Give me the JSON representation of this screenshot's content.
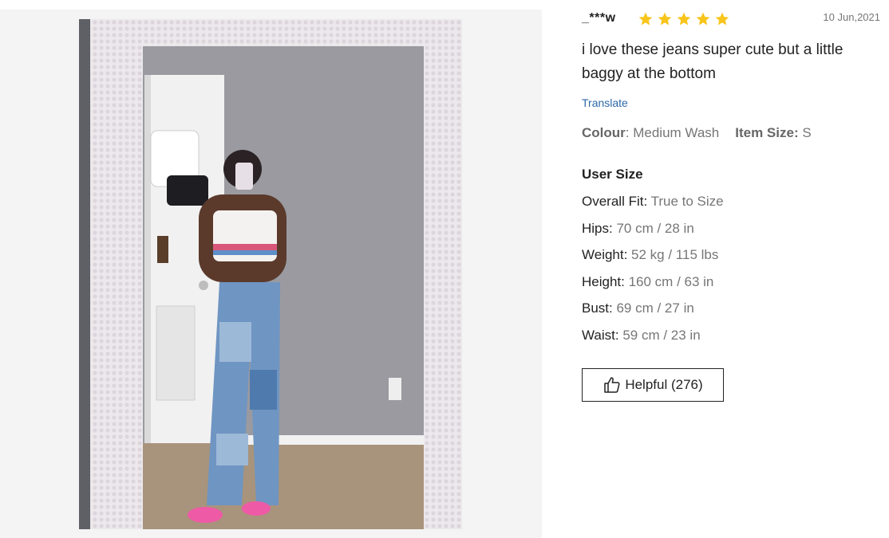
{
  "review": {
    "username": "_***w",
    "rating": 5,
    "rating_max": 5,
    "date": "10 Jun,2021",
    "comment": "i love these jeans super cute but a little baggy at the bottom",
    "translate_label": "Translate",
    "attributes": {
      "colour_label": "Colour",
      "colour_value": ": Medium Wash",
      "item_size_label": "Item Size:",
      "item_size_value": " S"
    },
    "user_size": {
      "title": "User Size",
      "rows": [
        {
          "label": "Overall Fit:",
          "value": " True to Size"
        },
        {
          "label": "Hips:",
          "value": " 70 cm / 28 in"
        },
        {
          "label": "Weight:",
          "value": " 52 kg / 115 lbs"
        },
        {
          "label": "Height:",
          "value": " 160 cm / 63 in"
        },
        {
          "label": "Bust:",
          "value": " 69 cm / 27 in"
        },
        {
          "label": "Waist:",
          "value": " 59 cm / 23 in"
        }
      ]
    },
    "helpful_label": "Helpful (276)"
  },
  "colors": {
    "star": "#f8c51c",
    "link": "#2d68a8",
    "muted_text": "#767676",
    "text": "#222222",
    "panel_bg": "#f4f4f4"
  },
  "icons": {
    "star": "star-icon",
    "helpful": "thumbs-up-icon"
  }
}
